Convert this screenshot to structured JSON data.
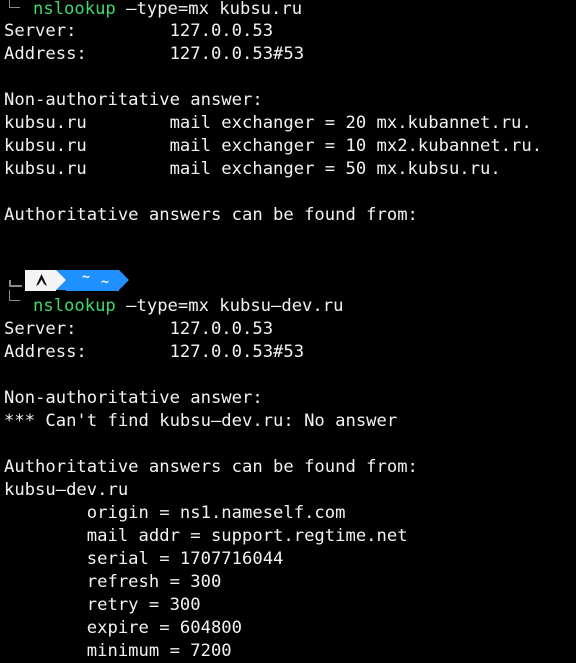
{
  "session1": {
    "command_name": "nslookup",
    "command_args": " –type=mx kubsu.ru",
    "server_line": "Server:         127.0.0.53",
    "address_line": "Address:        127.0.0.53#53",
    "nonauth_line": "Non-authoritative answer:",
    "mx_lines": [
      "kubsu.ru        mail exchanger = 20 mx.kubannet.ru.",
      "kubsu.ru        mail exchanger = 10 mx2.kubannet.ru.",
      "kubsu.ru        mail exchanger = 50 mx.kubsu.ru."
    ],
    "auth_line": "Authoritative answers can be found from:"
  },
  "prompt": {
    "dir_symbol": "~",
    "dir_symbol_small": "~",
    "os_icon": "arch-linux-icon",
    "colors": {
      "os_segment": "#f4f4f4",
      "dir_segment": "#1e90ff",
      "command": "#3fd96b"
    }
  },
  "session2": {
    "command_name": "nslookup",
    "command_args": " –type=mx kubsu–dev.ru",
    "server_line": "Server:         127.0.0.53",
    "address_line": "Address:        127.0.0.53#53",
    "nonauth_line": "Non-authoritative answer:",
    "error_line": "*** Can't find kubsu–dev.ru: No answer",
    "auth_line": "Authoritative answers can be found from:",
    "domain_line": "kubsu–dev.ru",
    "soa_lines": [
      "        origin = ns1.nameself.com",
      "        mail addr = support.regtime.net",
      "        serial = 1707716044",
      "        refresh = 300",
      "        retry = 300",
      "        expire = 604800",
      "        minimum = 7200"
    ]
  }
}
